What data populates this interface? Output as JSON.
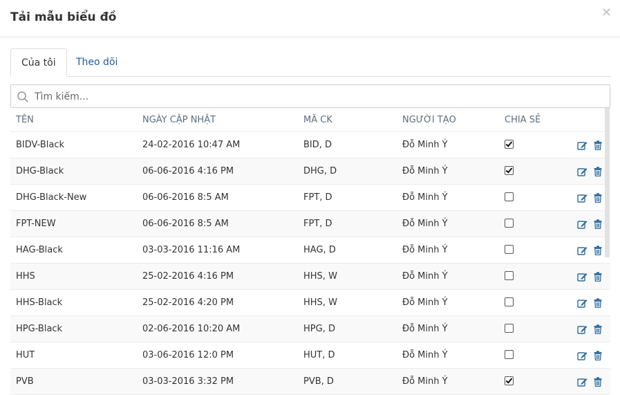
{
  "dialog": {
    "title": "Tải mẫu biểu đồ",
    "close_icon": "close-icon"
  },
  "tabs": [
    {
      "label": "Của tôi",
      "active": true
    },
    {
      "label": "Theo dõi",
      "active": false
    }
  ],
  "search": {
    "placeholder": "Tìm kiếm...",
    "value": ""
  },
  "table": {
    "columns": [
      "TÊN",
      "NGÀY CẬP NHẬT",
      "MÃ CK",
      "NGƯỜI TẠO",
      "CHIA SẺ"
    ],
    "rows": [
      {
        "name": "BIDV-Black",
        "date": "24-02-2016 10:47 AM",
        "code": "BID, D",
        "creator": "Đỗ Minh Ý",
        "shared": true
      },
      {
        "name": "DHG-Black",
        "date": "06-06-2016 4:16 PM",
        "code": "DHG, D",
        "creator": "Đỗ Minh Ý",
        "shared": true
      },
      {
        "name": "DHG-Black-New",
        "date": "06-06-2016 8:5 AM",
        "code": "FPT, D",
        "creator": "Đỗ Minh Ý",
        "shared": false
      },
      {
        "name": "FPT-NEW",
        "date": "06-06-2016 8:5 AM",
        "code": "FPT, D",
        "creator": "Đỗ Minh Ý",
        "shared": false
      },
      {
        "name": "HAG-Black",
        "date": "03-03-2016 11:16 AM",
        "code": "HAG, D",
        "creator": "Đỗ Minh Ý",
        "shared": false
      },
      {
        "name": "HHS",
        "date": "25-02-2016 4:16 PM",
        "code": "HHS, W",
        "creator": "Đỗ Minh Ý",
        "shared": false
      },
      {
        "name": "HHS-Black",
        "date": "25-02-2016 4:20 PM",
        "code": "HHS, W",
        "creator": "Đỗ Minh Ý",
        "shared": false
      },
      {
        "name": "HPG-Black",
        "date": "02-06-2016 10:20 AM",
        "code": "HPG, D",
        "creator": "Đỗ Minh Ý",
        "shared": false
      },
      {
        "name": "HUT",
        "date": "03-06-2016 12:0 PM",
        "code": "HUT, D",
        "creator": "Đỗ Minh Ý",
        "shared": false
      },
      {
        "name": "PVB",
        "date": "03-03-2016 3:32 PM",
        "code": "PVB, D",
        "creator": "Đỗ Minh Ý",
        "shared": true
      }
    ]
  },
  "colors": {
    "accent": "#1f5aa6",
    "icon": "#2b6c9f",
    "header_text": "#5a6e80"
  }
}
